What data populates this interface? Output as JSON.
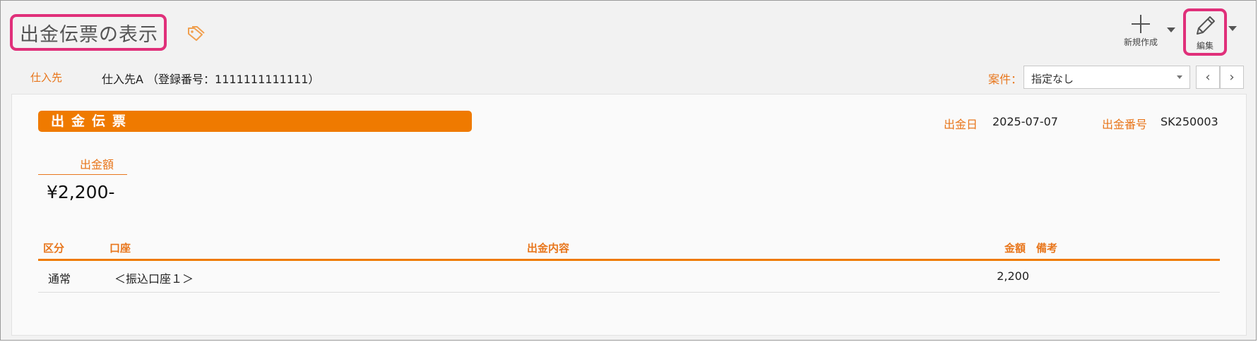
{
  "page": {
    "title": "出金伝票の表示"
  },
  "toolbar": {
    "new_label": "新規作成",
    "edit_label": "編集"
  },
  "supplier": {
    "label": "仕入先",
    "value": "仕入先A （登録番号：1111111111111）"
  },
  "case": {
    "label": "案件：",
    "selected": "指定なし",
    "prev": "‹",
    "next": "›"
  },
  "document": {
    "banner": "出金伝票",
    "date_label": "出金日",
    "date_value": "2025-07-07",
    "number_label": "出金番号",
    "number_value": "SK250003",
    "amount_label": "出金額",
    "amount_value": "¥2,200-"
  },
  "table": {
    "headers": {
      "kubun": "区分",
      "account": "口座",
      "content": "出金内容",
      "amount": "金額",
      "note": "備考"
    },
    "rows": [
      {
        "kubun": "通常",
        "account": "＜振込口座１＞",
        "content": "",
        "amount": "2,200",
        "note": ""
      }
    ]
  },
  "colors": {
    "accent": "#ef7a00",
    "highlight": "#e0307a",
    "label": "#e8761c"
  }
}
